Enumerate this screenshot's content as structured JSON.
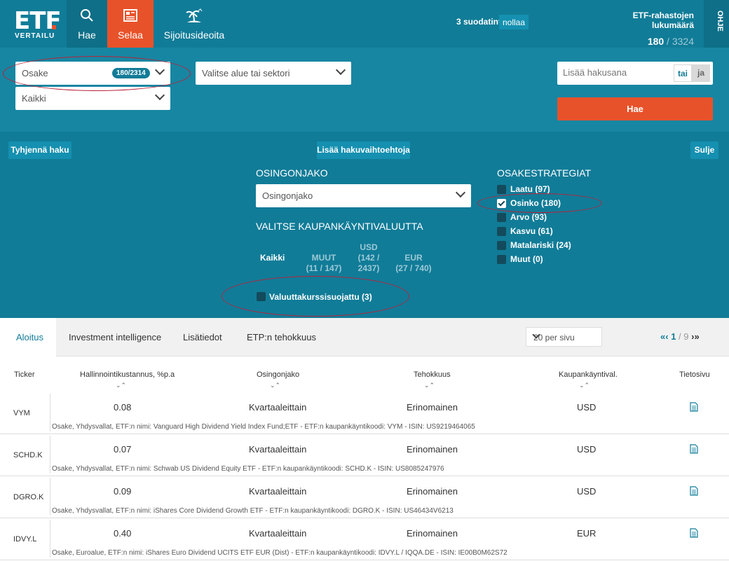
{
  "nav": {
    "logo_main": "ETF",
    "logo_sub": "VERTAILU",
    "hae": "Hae",
    "selaa": "Selaa",
    "ideas": "Sijoitusideoita",
    "filters_text": "3 suodatinta",
    "reset": "nollaa",
    "count_title": "ETF-rahastojen lukumäärä",
    "count_shown": "180",
    "count_sep": " / ",
    "count_total": "3324",
    "help": "OHJE"
  },
  "search": {
    "asset_class": "Osake",
    "asset_badge": "180/2314",
    "region_all": "Kaikki",
    "sector_placeholder": "Valitse alue tai sektori",
    "keyword_placeholder": "Lisää hakusana",
    "or": "tai",
    "and": "ja",
    "search_button": "Hae"
  },
  "panel": {
    "clear": "Tyhjennä haku",
    "more": "Lisää hakuvaihtoehtoja",
    "close": "Sulje",
    "dividend_title": "OSINGONJAKO",
    "dividend_select": "Osingonjako",
    "currency_title": "VALITSE KAUPANKÄYNTIVALUUTTA",
    "currency_all": "Kaikki",
    "currencies": [
      {
        "l1": "",
        "l2": "MUUT",
        "l3": "(11 / 147)"
      },
      {
        "l1": "USD",
        "l2": "(142 /",
        "l3": "2437)"
      },
      {
        "l1": "",
        "l2": "EUR",
        "l3": "(27 / 740)"
      }
    ],
    "hedged": "Valuuttakurssisuojattu (3)",
    "strategy_title": "OSAKESTRATEGIAT",
    "strategies": [
      {
        "label": "Laatu (97)",
        "checked": false
      },
      {
        "label": "Osinko (180)",
        "checked": true
      },
      {
        "label": "Arvo (93)",
        "checked": false
      },
      {
        "label": "Kasvu (61)",
        "checked": false
      },
      {
        "label": "Matalariski (24)",
        "checked": false
      },
      {
        "label": "Muut (0)",
        "checked": false
      }
    ]
  },
  "tabs": [
    "Aloitus",
    "Investment intelligence",
    "Lisätiedot",
    "ETP:n tehokkuus"
  ],
  "per_page": "20 per sivu",
  "pager": {
    "prev": "«‹",
    "current": "1",
    "sep": " / ",
    "total": "9",
    "next": "›»"
  },
  "columns": [
    "Ticker",
    "Hallinnointikustannus, %p.a",
    "Osingonjako",
    "Tehokkuus",
    "Kaupankäyntival.",
    "Tietosivu"
  ],
  "sort_glyph": "⌄⌃",
  "rows": [
    {
      "ticker": "VYM",
      "fee": "0.08",
      "dividend": "Kvartaaleittain",
      "efficiency": "Erinomainen",
      "currency": "USD",
      "desc": "Osake, Yhdysvallat, ETF:n nimi: Vanguard High Dividend Yield Index Fund;ETF - ETF:n kaupankäyntikoodi: VYM - ISIN: US9219464065"
    },
    {
      "ticker": "SCHD.K",
      "fee": "0.07",
      "dividend": "Kvartaaleittain",
      "efficiency": "Erinomainen",
      "currency": "USD",
      "desc": "Osake, Yhdysvallat, ETF:n nimi: Schwab US Dividend Equity ETF - ETF:n kaupankäyntikoodi: SCHD.K - ISIN: US8085247976"
    },
    {
      "ticker": "DGRO.K",
      "fee": "0.09",
      "dividend": "Kvartaaleittain",
      "efficiency": "Erinomainen",
      "currency": "USD",
      "desc": "Osake, Yhdysvallat, ETF:n nimi: iShares Core Dividend Growth ETF - ETF:n kaupankäyntikoodi: DGRO.K - ISIN: US46434V6213"
    },
    {
      "ticker": "IDVY.L",
      "fee": "0.40",
      "dividend": "Kvartaaleittain",
      "efficiency": "Erinomainen",
      "currency": "EUR",
      "desc": "Osake, Euroalue, ETF:n nimi: iShares Euro Dividend UCITS ETF EUR (Dist) - ETF:n kaupankäyntikoodi: IDVY.L / IQQA.DE - ISIN: IE00B0M62S72"
    }
  ]
}
